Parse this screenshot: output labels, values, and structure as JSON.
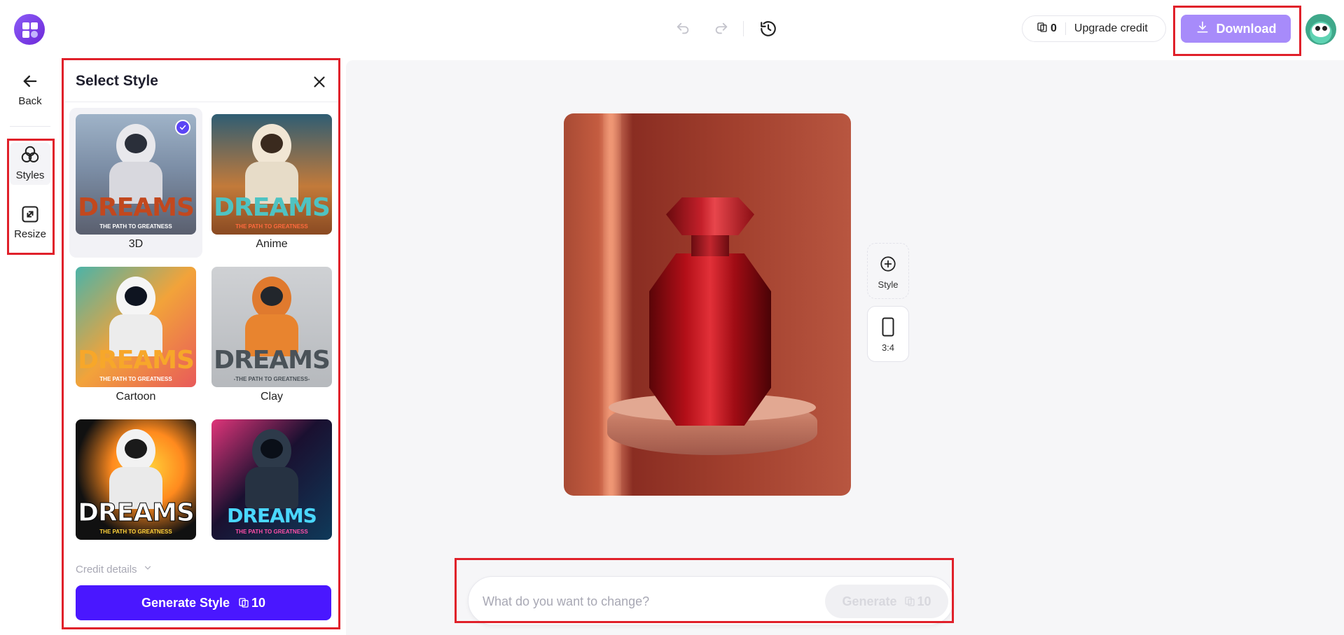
{
  "header": {
    "credits_count": "0",
    "upgrade_label": "Upgrade credit",
    "download_label": "Download"
  },
  "rail": {
    "back_label": "Back",
    "styles_label": "Styles",
    "resize_label": "Resize"
  },
  "panel": {
    "title": "Select Style",
    "styles": [
      {
        "label": "3D",
        "selected": true,
        "thumb_text": "DREAMS",
        "thumb_sub": "THE PATH TO GREATNESS"
      },
      {
        "label": "Anime",
        "selected": false,
        "thumb_text": "DREAMS",
        "thumb_sub": "THE PATH TO GREATNESS"
      },
      {
        "label": "Cartoon",
        "selected": false,
        "thumb_text": "DREAMS",
        "thumb_sub": "THE PATH TO GREATNESS"
      },
      {
        "label": "Clay",
        "selected": false,
        "thumb_text": "DREAMS",
        "thumb_sub": "-THE PATH TO GREATNESS-"
      },
      {
        "label": "",
        "selected": false,
        "thumb_text": "DREAMS",
        "thumb_sub": "THE PATH TO GREATNESS"
      },
      {
        "label": "",
        "selected": false,
        "thumb_text": "DREAMS",
        "thumb_sub": "THE PATH TO GREATNESS"
      }
    ],
    "credit_details_label": "Credit details",
    "generate_style_label": "Generate Style",
    "generate_style_cost": "10"
  },
  "canvas": {
    "style_tool_label": "Style",
    "ratio_label": "3:4"
  },
  "prompt": {
    "placeholder": "What do you want to change?",
    "generate_label": "Generate",
    "generate_cost": "10"
  },
  "colors": {
    "accent": "#4a17ff",
    "download_bg": "#a78bfa",
    "highlight": "#e0202a"
  }
}
